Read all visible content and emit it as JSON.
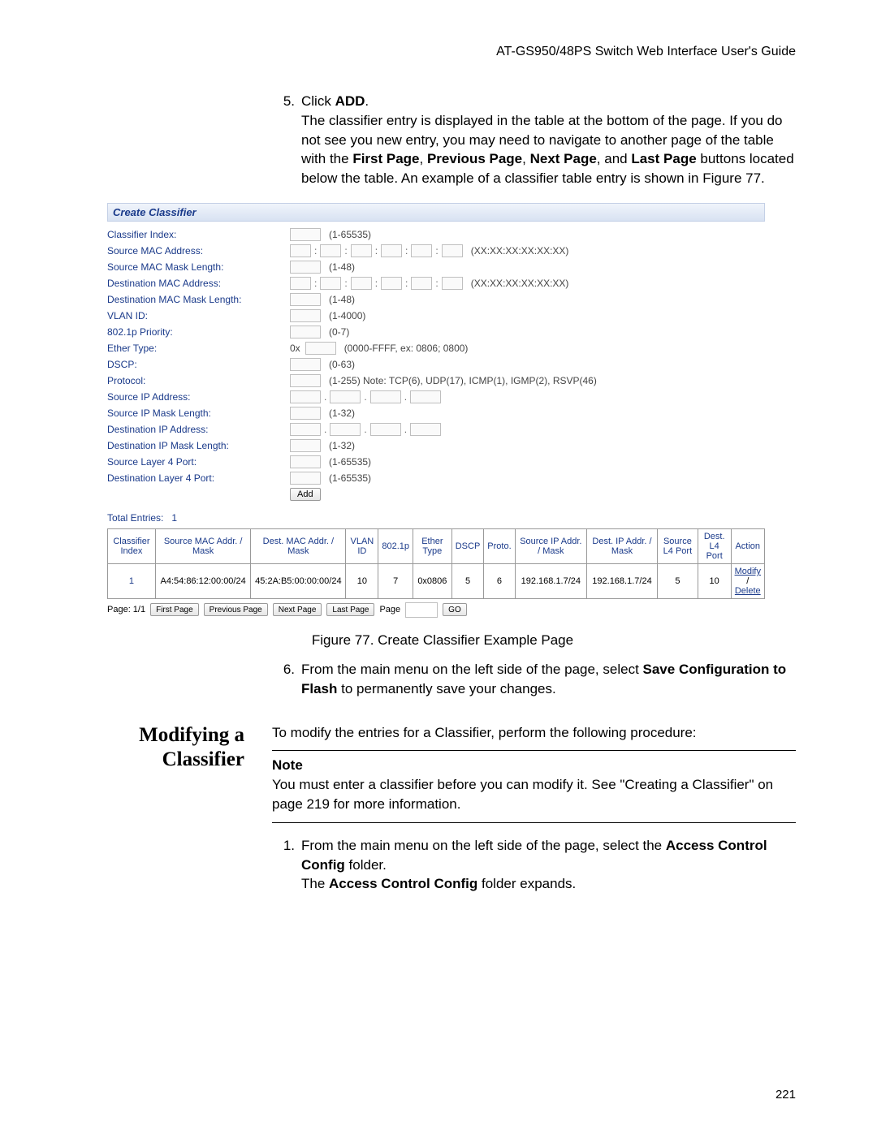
{
  "header": {
    "guide": "AT-GS950/48PS Switch Web Interface User's Guide"
  },
  "step5": {
    "num": "5.",
    "line1a": "Click ",
    "line1b": "ADD",
    "line1c": ".",
    "para": "The classifier entry is displayed in the table at the bottom of the page. If you do not see you new entry, you may need to navigate to another page of the table with the ",
    "k1": "First Page",
    "c1": ", ",
    "k2": "Previous Page",
    "c2": ", ",
    "k3": "Next Page",
    "c3": ", and ",
    "k4": "Last Page",
    "tail": " buttons located below the table. An example of a classifier table entry is shown in Figure 77."
  },
  "figure": {
    "title": "Create Classifier",
    "labels": {
      "idx": "Classifier Index:",
      "smac": "Source MAC Address:",
      "smask": "Source MAC Mask Length:",
      "dmac": "Destination MAC Address:",
      "dmask": "Destination MAC Mask Length:",
      "vlan": "VLAN ID:",
      "pri": "802.1p Priority:",
      "eth": "Ether Type:",
      "dscp": "DSCP:",
      "proto": "Protocol:",
      "sip": "Source IP Address:",
      "sipm": "Source IP Mask Length:",
      "dip": "Destination IP Address:",
      "dipm": "Destination IP Mask Length:",
      "sl4": "Source Layer 4 Port:",
      "dl4": "Destination Layer 4 Port:"
    },
    "hints": {
      "idx": "(1-65535)",
      "mac": "(XX:XX:XX:XX:XX:XX)",
      "mask48": "(1-48)",
      "vlan": "(1-4000)",
      "pri": "(0-7)",
      "eth_prefix": "0x",
      "eth": "(0000-FFFF, ex: 0806; 0800)",
      "dscp": "(0-63)",
      "proto": "(1-255) Note: TCP(6), UDP(17), ICMP(1), IGMP(2), RSVP(46)",
      "ipm": "(1-32)",
      "l4": "(1-65535)"
    },
    "add_label": "Add",
    "total_label": "Total Entries:",
    "total_value": "1",
    "headers": [
      "Classifier Index",
      "Source MAC Addr. / Mask",
      "Dest. MAC Addr. / Mask",
      "VLAN ID",
      "802.1p",
      "Ether Type",
      "DSCP",
      "Proto.",
      "Source IP Addr. / Mask",
      "Dest. IP Addr. / Mask",
      "Source L4 Port",
      "Dest. L4 Port",
      "Action"
    ],
    "row": {
      "idx": "1",
      "smac": "A4:54:86:12:00:00/24",
      "dmac": "45:2A:B5:00:00:00/24",
      "vlan": "10",
      "pri": "7",
      "eth": "0x0806",
      "dscp": "5",
      "proto": "6",
      "sip": "192.168.1.7/24",
      "dip": "192.168.1.7/24",
      "sl4": "5",
      "dl4": "10",
      "modify": "Modify",
      "sep": "/",
      "delete": "Delete"
    },
    "pager": {
      "page_lbl": "Page: 1/1",
      "first": "First Page",
      "prev": "Previous Page",
      "next": "Next Page",
      "last": "Last Page",
      "page_word": "Page",
      "go": "GO"
    }
  },
  "fig_caption": "Figure 77. Create Classifier Example Page",
  "step6": {
    "num": "6.",
    "a": "From the main menu on the left side of the page, select ",
    "b1": "Save Configuration to Flash",
    "c": " to permanently save your changes."
  },
  "section": {
    "heading1": "Modifying a",
    "heading2": "Classifier",
    "intro": "To modify the entries for a Classifier, perform the following procedure:",
    "note_head": "Note",
    "note_body": "You must enter a classifier before you can modify it. See \"Creating a Classifier\" on page 219 for more information."
  },
  "mod_step1": {
    "num": "1.",
    "a": "From the main menu on the left side of the page, select the ",
    "b": "Access Control Config",
    "c": " folder.",
    "d1": "The ",
    "d2": "Access Control Config",
    "d3": " folder expands."
  },
  "page_number": "221"
}
